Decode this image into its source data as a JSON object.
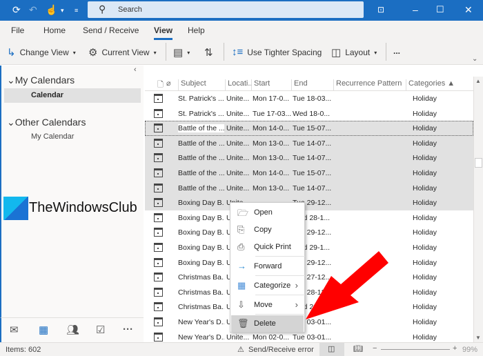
{
  "titlebar": {
    "search_placeholder": "Search",
    "icons": [
      "sync-icon",
      "undo-icon",
      "touch-mode-icon",
      "customize-icon",
      "ribbon-display-icon",
      "minimize-icon",
      "maximize-icon",
      "close-icon"
    ]
  },
  "ribbon": {
    "tabs": [
      "File",
      "Home",
      "Send / Receive",
      "View",
      "Help"
    ],
    "active_tab": "View",
    "tools": {
      "change_view": "Change View",
      "current_view": "Current View",
      "tighter_spacing": "Use Tighter Spacing",
      "layout": "Layout",
      "more": "..."
    }
  },
  "sidebar": {
    "my_calendars": "My Calendars",
    "calendar": "Calendar",
    "other_calendars": "Other Calendars",
    "my_calendar": "My Calendar",
    "watermark": "TheWindowsClub"
  },
  "table": {
    "headers": [
      "Subject",
      "Locati...",
      "Start",
      "End",
      "Recurrence Pattern",
      "Categories"
    ],
    "rows": [
      {
        "subject": "St. Patrick's ...",
        "location": "Unite...",
        "start": "Mon 17-0...",
        "end": "Tue 18-03...",
        "category": "Holiday"
      },
      {
        "subject": "St. Patrick's ...",
        "location": "Unite...",
        "start": "Tue 17-03...",
        "end": "Wed 18-0...",
        "category": "Holiday"
      },
      {
        "subject": "Battle of the ...",
        "location": "Unite...",
        "start": "Mon 14-0...",
        "end": "Tue 15-07...",
        "category": "Holiday"
      },
      {
        "subject": "Battle of the ...",
        "location": "Unite...",
        "start": "Mon 13-0...",
        "end": "Tue 14-07...",
        "category": "Holiday"
      },
      {
        "subject": "Battle of the ...",
        "location": "Unite...",
        "start": "Mon 13-0...",
        "end": "Tue 14-07...",
        "category": "Holiday"
      },
      {
        "subject": "Battle of the ...",
        "location": "Unite...",
        "start": "Mon 14-0...",
        "end": "Tue 15-07...",
        "category": "Holiday"
      },
      {
        "subject": "Battle of the ...",
        "location": "Unite...",
        "start": "Mon 13-0...",
        "end": "Tue 14-07...",
        "category": "Holiday"
      },
      {
        "subject": "Boxing Day B...",
        "location": "Unite...",
        "start": "",
        "end": "Tue 29-12...",
        "category": "Holiday"
      },
      {
        "subject": "Boxing Day B...",
        "location": "U",
        "start": "",
        "end": "Wed 28-1...",
        "category": "Holiday"
      },
      {
        "subject": "Boxing Day B...",
        "location": "U",
        "start": "",
        "end": "Tue 29-12...",
        "category": "Holiday"
      },
      {
        "subject": "Boxing Day B...",
        "location": "U",
        "start": "",
        "end": "Wed 29-1...",
        "category": "Holiday"
      },
      {
        "subject": "Boxing Day B...",
        "location": "U",
        "start": "",
        "end": "Tue 29-12...",
        "category": "Holiday"
      },
      {
        "subject": "Christmas Ba...",
        "location": "U",
        "start": "",
        "end": "Tue 27-12...",
        "category": "Holiday"
      },
      {
        "subject": "Christmas Ba...",
        "location": "U",
        "start": "",
        "end": "Tue 28-12...",
        "category": "Holiday"
      },
      {
        "subject": "Christmas Ba...",
        "location": "U",
        "start": "",
        "end": "Wed 2...",
        "category": "Holiday"
      },
      {
        "subject": "New Year's D...",
        "location": "U",
        "start": "",
        "end": "Tue 03-01...",
        "category": "Holiday"
      },
      {
        "subject": "New Year's D...",
        "location": "Unite...",
        "start": "Mon 02-0...",
        "end": "Tue 03-01...",
        "category": "Holiday"
      }
    ]
  },
  "context_menu": {
    "items": [
      "Open",
      "Copy",
      "Quick Print",
      "Forward",
      "Categorize",
      "Move",
      "Delete"
    ],
    "highlighted": "Delete"
  },
  "status": {
    "items": "Items: 602",
    "error": "Send/Receive error",
    "zoom": "99%"
  },
  "colors": {
    "accent": "#1b6ec2",
    "arrow": "#ff0000"
  }
}
